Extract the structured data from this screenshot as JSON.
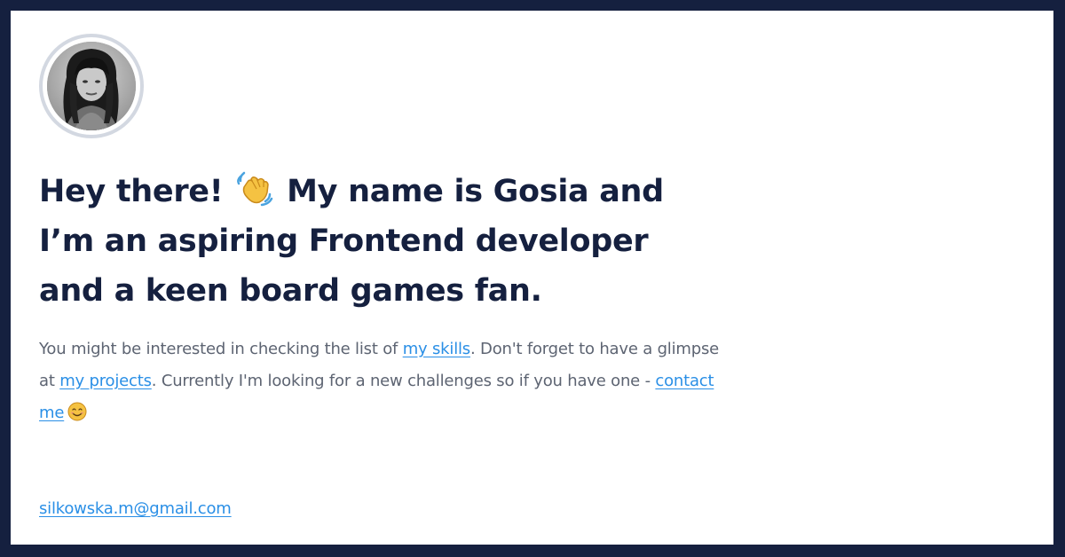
{
  "profile": {
    "avatar_alt": "avatar"
  },
  "heading": {
    "line1_before_emoji": "Hey there! ",
    "line1_after_emoji": " My name is Gosia and",
    "line2": "I’m an aspiring Frontend developer",
    "line3": "and a keen board games fan."
  },
  "intro": {
    "text1": "You might be interested in checking the list of ",
    "skills_link": "my skills",
    "text2": ". Don't forget to have a glimpse at ",
    "projects_link": "my projects",
    "text3": ". Currently I'm looking for a new challenges so if you have one - ",
    "contact_link": "contact me"
  },
  "contact": {
    "email": "silkowska.m@gmail.com"
  },
  "icons": {
    "wave": "waving-hand-icon",
    "smile": "smiling-face-icon"
  },
  "colors": {
    "frame": "#15203f",
    "heading": "#15203f",
    "body_text": "#5d6472",
    "link": "#2a8fe6",
    "avatar_ring": "#d3d8e1"
  }
}
